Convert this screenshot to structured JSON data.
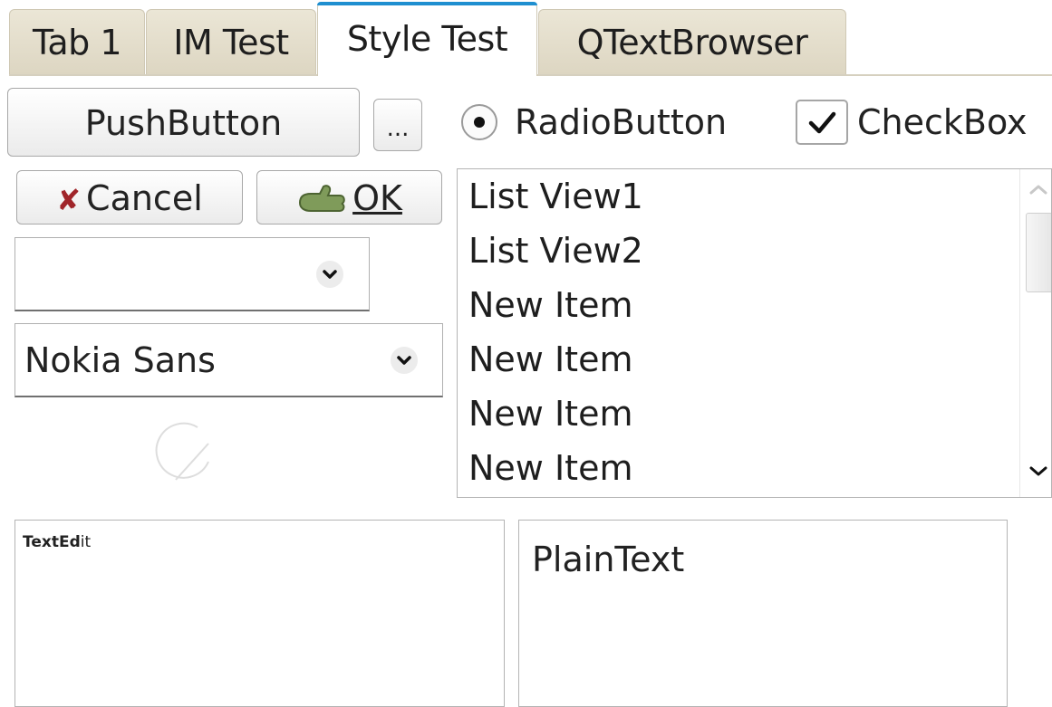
{
  "tabs": [
    {
      "label": "Tab 1",
      "active": false
    },
    {
      "label": "IM Test",
      "active": false
    },
    {
      "label": "Style Test",
      "active": true
    },
    {
      "label": "QTextBrowser",
      "active": false
    }
  ],
  "accent_color": "#1f8fd0",
  "row1": {
    "push_button": "PushButton",
    "tool_button": "...",
    "radio_label": "RadioButton",
    "radio_checked": true,
    "checkbox_label": "CheckBox",
    "checkbox_checked": true
  },
  "row2": {
    "cancel_label": "Cancel",
    "ok_label": "OK"
  },
  "combo_empty": {
    "value": ""
  },
  "font_combo": {
    "value": "Nokia Sans"
  },
  "list_view": {
    "items": [
      "List View1",
      "List View2",
      "New Item",
      "New Item",
      "New Item",
      "New Item"
    ]
  },
  "text_edit": {
    "bold_part": "TextEd",
    "plain_part": "it"
  },
  "plain_text_edit": {
    "value": "PlainText"
  },
  "icons": {
    "cancel": "x-mark-icon",
    "ok": "thumb-icon",
    "dial": "dial-icon",
    "scroll_up": "chevron-up-icon",
    "scroll_down": "chevron-down-icon"
  }
}
